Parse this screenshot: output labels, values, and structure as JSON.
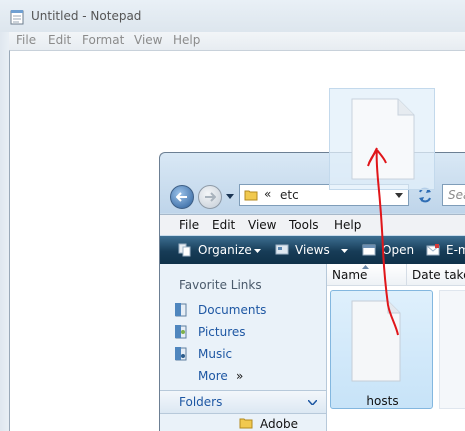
{
  "notepad": {
    "title": "Untitled - Notepad",
    "menu": [
      "File",
      "Edit",
      "Format",
      "View",
      "Help"
    ]
  },
  "explorer": {
    "address": {
      "chevron": "«",
      "path": "etc"
    },
    "search_placeholder": "Sea",
    "menu": [
      "File",
      "Edit",
      "View",
      "Tools",
      "Help"
    ],
    "toolbar": {
      "organize": "Organize",
      "views": "Views",
      "open": "Open",
      "email": "E-m"
    },
    "nav_pane": {
      "favorite_links_heading": "Favorite Links",
      "links": [
        "Documents",
        "Pictures",
        "Music"
      ],
      "more": "More",
      "more_arrow": "»",
      "folders_label": "Folders",
      "tree_items": [
        "Adobe"
      ]
    },
    "columns": [
      "Name",
      "Date taker"
    ],
    "files": [
      {
        "name": "hosts",
        "selected": true
      }
    ]
  },
  "colors": {
    "toolbar_dark": "#173c57",
    "link_blue": "#1e57a3",
    "annotation_red": "#e0161a",
    "selection_blue": "#c7e3f8"
  }
}
